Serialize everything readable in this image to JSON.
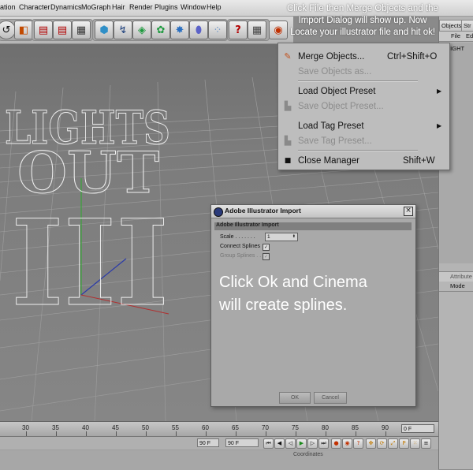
{
  "menubar": {
    "items": [
      "ation",
      "Character",
      "Dynamics",
      "MoGraph",
      "Hair",
      "Render",
      "Plugins",
      "Window",
      "Help"
    ]
  },
  "toolbar": {
    "icons": [
      "undo-icon",
      "coordinate-system-icon",
      "render-view-icon",
      "render-picture-viewer-icon",
      "render-settings-icon",
      "cube-icon",
      "spline-pen-icon",
      "nurbs-icon",
      "array-icon",
      "particle-icon",
      "deformer-icon",
      "scene-icon",
      "help-icon",
      "material-icon",
      "scene-light-icon"
    ]
  },
  "instruction": {
    "text": "Click File then Merge Objects and the Import Dialog  will show up.  Now Locate your illustrator file and hit ok!"
  },
  "right_panel": {
    "tabs": [
      "Objects",
      "Str"
    ],
    "menu": [
      "File",
      "Ed"
    ],
    "object_item": "LIGHT",
    "attributes_tab": "Attribute",
    "mode_label": "Mode"
  },
  "file_menu": {
    "items": [
      {
        "label": "Merge Objects...",
        "shortcut": "Ctrl+Shift+O",
        "enabled": true,
        "icon": "merge-objects-icon"
      },
      {
        "label": "Save Objects as...",
        "shortcut": "",
        "enabled": false,
        "icon": ""
      },
      {
        "label": "Load Object Preset",
        "shortcut": "",
        "enabled": true,
        "submenu": true,
        "icon": ""
      },
      {
        "label": "Save Object Preset...",
        "shortcut": "",
        "enabled": false,
        "icon": "preset-icon"
      },
      {
        "label": "Load Tag Preset",
        "shortcut": "",
        "enabled": true,
        "submenu": true,
        "icon": ""
      },
      {
        "label": "Save Tag Preset...",
        "shortcut": "",
        "enabled": false,
        "icon": "preset-icon"
      },
      {
        "label": "Close Manager",
        "shortcut": "Shift+W",
        "enabled": true,
        "icon": "close-manager-icon"
      }
    ]
  },
  "viewport": {
    "text_lines": [
      "LIGHTS",
      "OUT",
      "III"
    ]
  },
  "dialog": {
    "title": "Adobe Illustrator Import",
    "section": "Adobe Illustrator Import",
    "scale_label": "Scale . . . . . . .",
    "scale_value": "1",
    "connect_splines_label": "Connect Splines",
    "connect_splines_checked": true,
    "group_splines_label": "Group Splines . .",
    "group_splines_checked": true,
    "note": "Click Ok and Cinema will create splines.",
    "ok_label": "OK",
    "cancel_label": "Cancel"
  },
  "timeline": {
    "ticks": [
      "30",
      "35",
      "40",
      "45",
      "50",
      "55",
      "60",
      "65",
      "70",
      "75",
      "80",
      "85",
      "90"
    ],
    "frame_value": "0 F",
    "preview_min": "90 F",
    "preview_max": "90 F",
    "coordinates_label": "Coordinates"
  }
}
